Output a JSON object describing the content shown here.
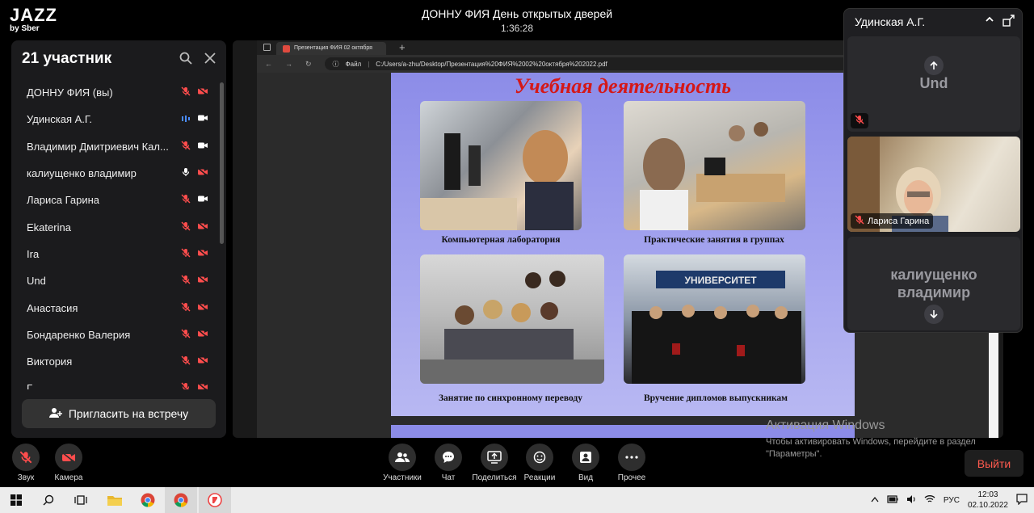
{
  "app": {
    "logo_line1": "JAZZ",
    "logo_line2": "by Sber",
    "meeting_title": "ДОННУ ФИЯ День открытых дверей",
    "meeting_time": "1:36:28"
  },
  "participants_panel": {
    "title": "21 участник",
    "items": [
      {
        "name": "ДОННУ ФИЯ (вы)",
        "mic": "muted",
        "cam": "off"
      },
      {
        "name": "Удинская А.Г.",
        "mic": "speaking",
        "cam": "on"
      },
      {
        "name": "Владимир Дмитриевич Кал...",
        "mic": "muted",
        "cam": "on"
      },
      {
        "name": "калиущенко владимир",
        "mic": "on",
        "cam": "off"
      },
      {
        "name": "Лариса Гарина",
        "mic": "muted",
        "cam": "on"
      },
      {
        "name": "Ekaterina",
        "mic": "muted",
        "cam": "off"
      },
      {
        "name": "Ira",
        "mic": "muted",
        "cam": "off"
      },
      {
        "name": "Und",
        "mic": "muted",
        "cam": "off"
      },
      {
        "name": "Анастасия",
        "mic": "muted",
        "cam": "off"
      },
      {
        "name": "Бондаренко Валерия",
        "mic": "muted",
        "cam": "off"
      },
      {
        "name": "Виктория",
        "mic": "muted",
        "cam": "off"
      },
      {
        "name": "Г...",
        "mic": "muted",
        "cam": "off"
      }
    ],
    "invite_label": "Пригласить на встречу"
  },
  "browser": {
    "tab_title": "Презентация ФИЯ 02 октября",
    "file_label": "Файл",
    "url": "C:/Users/a-zhu/Desktop/Презентация%20ФИЯ%2002%20октября%202022.pdf"
  },
  "slide": {
    "title": "Учебная деятельность",
    "captions": [
      "Компьютерная лаборатория",
      "Практические занятия в группах",
      "Занятие по синхронному переводу",
      "Вручение дипломов выпускникам"
    ],
    "banner_text": "УНИВЕРСИТЕТ"
  },
  "video_tiles": {
    "speaker": "Удинская А.Г.",
    "tiles": [
      {
        "label": "Und",
        "badge": ""
      },
      {
        "label": "",
        "badge": "Лариса Гарина"
      },
      {
        "label": "калиущенко владимир",
        "badge": ""
      }
    ]
  },
  "controls": {
    "left": [
      {
        "label": "Звук"
      },
      {
        "label": "Камера"
      }
    ],
    "center": [
      {
        "label": "Участники"
      },
      {
        "label": "Чат"
      },
      {
        "label": "Поделиться"
      },
      {
        "label": "Реакции"
      },
      {
        "label": "Вид"
      },
      {
        "label": "Прочее"
      }
    ],
    "leave_label": "Выйти"
  },
  "watermark": {
    "line1": "Активация Windows",
    "line2": "Чтобы активировать Windows, перейдите в раздел \"Параметры\"."
  },
  "taskbar": {
    "lang": "РУС",
    "time": "12:03",
    "date": "02.10.2022"
  },
  "colors": {
    "accent_red": "#ff4d4d",
    "leave_red": "#ff5a4e",
    "slide_bg": "#9a9aec",
    "slide_title": "#d41818"
  }
}
